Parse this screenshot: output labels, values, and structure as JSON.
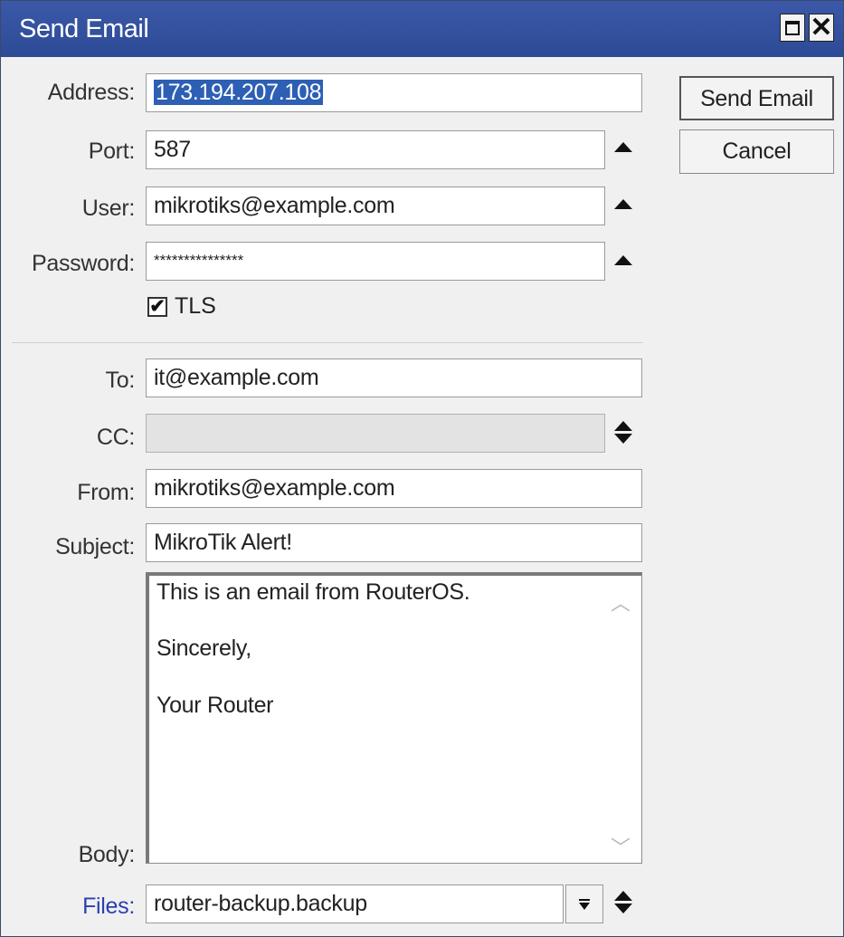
{
  "window": {
    "title": "Send Email"
  },
  "fields": {
    "address": {
      "label": "Address:",
      "value": "173.194.207.108"
    },
    "port": {
      "label": "Port:",
      "value": "587"
    },
    "user": {
      "label": "User:",
      "value": "mikrotiks@example.com"
    },
    "password": {
      "label": "Password:",
      "value": "***************"
    },
    "tls": {
      "label": "TLS",
      "checked": true
    },
    "to": {
      "label": "To:",
      "value": "it@example.com"
    },
    "cc": {
      "label": "CC:",
      "value": ""
    },
    "from": {
      "label": "From:",
      "value": "mikrotiks@example.com"
    },
    "subject": {
      "label": "Subject:",
      "value": "MikroTik Alert!"
    },
    "body": {
      "label": "Body:",
      "lines": [
        "This is an email from RouterOS.",
        "Sincerely,",
        "Your Router"
      ]
    },
    "files": {
      "label": "Files:",
      "value": "router-backup.backup"
    }
  },
  "buttons": {
    "send": "Send Email",
    "cancel": "Cancel"
  },
  "icons": {
    "maximize": "maximize-icon",
    "close": "close-icon",
    "check": "checkmark-icon"
  },
  "colors": {
    "titlebar": "#2d4a96",
    "selection": "#2d5fb4",
    "link_label": "#2b3fb0"
  }
}
